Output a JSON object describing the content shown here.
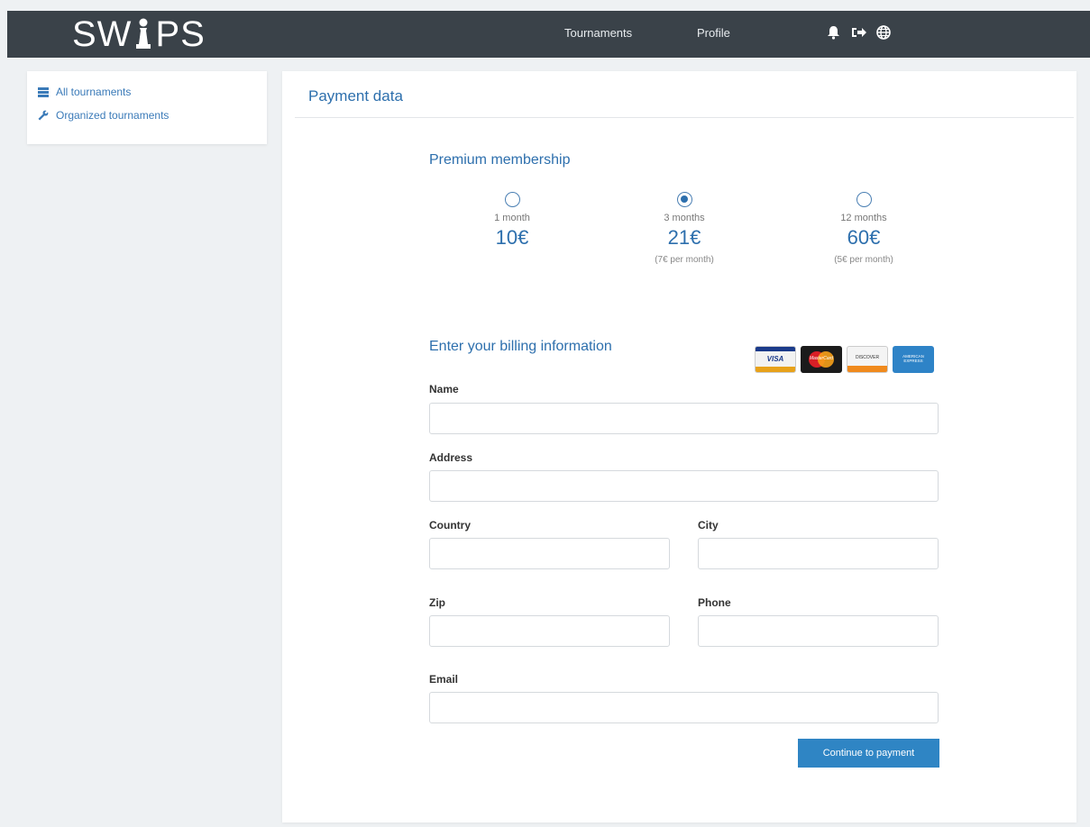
{
  "navbar": {
    "brand_prefix": "SW",
    "brand_suffix": "PS",
    "links": [
      "Tournaments",
      "Profile"
    ],
    "icons": [
      "bell-icon",
      "sign-out-icon",
      "globe-icon"
    ]
  },
  "sidebar": {
    "items": [
      {
        "label": "All tournaments",
        "icon": "list-icon"
      },
      {
        "label": "Organized tournaments",
        "icon": "wrench-icon"
      }
    ]
  },
  "main": {
    "title": "Payment data",
    "premium_title": "Premium membership",
    "plans": [
      {
        "period": "1 month",
        "price": "10€",
        "per_month": "",
        "selected": false
      },
      {
        "period": "3 months",
        "price": "21€",
        "per_month": "(7€ per month)",
        "selected": true
      },
      {
        "period": "12 months",
        "price": "60€",
        "per_month": "(5€ per month)",
        "selected": false
      }
    ],
    "billing_title": "Enter your billing information",
    "cards": [
      "VISA",
      "MasterCard",
      "DISCOVER",
      "AMERICAN EXPRESS"
    ],
    "fields": {
      "name": {
        "label": "Name",
        "value": ""
      },
      "address": {
        "label": "Address",
        "value": ""
      },
      "country": {
        "label": "Country",
        "value": ""
      },
      "city": {
        "label": "City",
        "value": ""
      },
      "zip": {
        "label": "Zip",
        "value": ""
      },
      "phone": {
        "label": "Phone",
        "value": ""
      },
      "email": {
        "label": "Email",
        "value": ""
      }
    },
    "submit_label": "Continue to payment"
  },
  "colors": {
    "navbar": "#3a4249",
    "accent": "#2d6fad",
    "button": "#2f85c4",
    "background": "#eef1f3"
  }
}
